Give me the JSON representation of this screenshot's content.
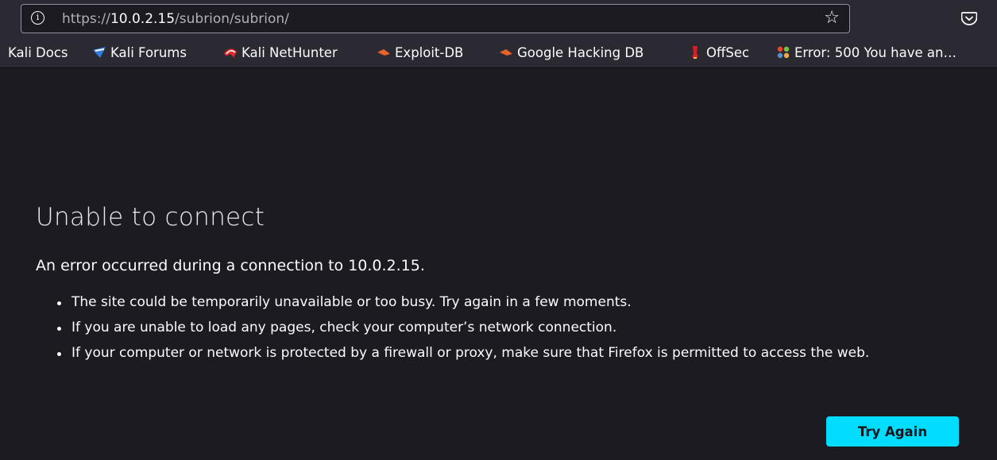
{
  "urlbar": {
    "url_scheme": "https://",
    "url_host": "10.0.2.15",
    "url_path": "/subrion/subrion/",
    "info_icon": "info-circle-icon",
    "bookmark_icon": "star-icon"
  },
  "toolbar": {
    "pocket_icon": "pocket-icon"
  },
  "bookmarks": [
    {
      "label": "Kali Docs",
      "icon": "kali-docs-icon"
    },
    {
      "label": "Kali Forums",
      "icon": "kali-forums-icon"
    },
    {
      "label": "Kali NetHunter",
      "icon": "kali-nethunter-icon"
    },
    {
      "label": "Exploit-DB",
      "icon": "exploit-db-icon"
    },
    {
      "label": "Google Hacking DB",
      "icon": "google-hacking-db-icon"
    },
    {
      "label": "OffSec",
      "icon": "offsec-icon"
    },
    {
      "label": "Error: 500 You have an…",
      "icon": "joomla-icon"
    }
  ],
  "error_page": {
    "title": "Unable to connect",
    "subtitle": "An error occurred during a connection to 10.0.2.15.",
    "reasons": [
      "The site could be temporarily unavailable or too busy. Try again in a few moments.",
      "If you are unable to load any pages, check your computer’s network connection.",
      "If your computer or network is protected by a firewall or proxy, make sure that Firefox is permitted to access the web."
    ],
    "try_again_label": "Try Again"
  },
  "colors": {
    "page_background": "#1c1b22",
    "toolbar_background": "#2b2a33",
    "accent_button": "#00ddff"
  }
}
